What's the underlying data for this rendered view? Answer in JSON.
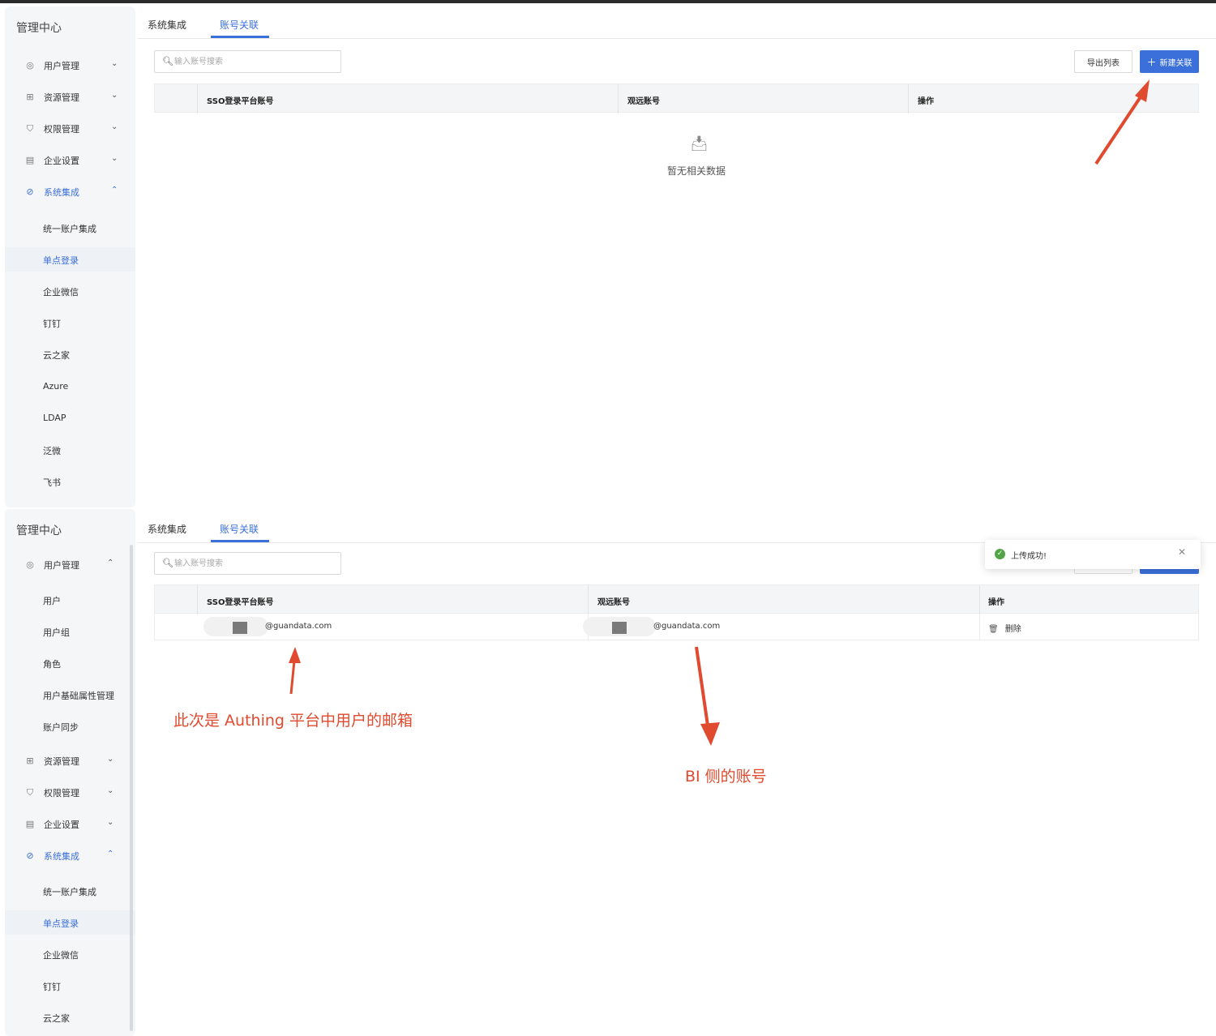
{
  "app": {
    "title": "管理中心"
  },
  "sidebar": {
    "menus": {
      "user": "用户管理",
      "resource": "资源管理",
      "permission": "权限管理",
      "enterprise": "企业设置",
      "integration": "系统集成"
    },
    "integration_items": [
      "统一账户集成",
      "单点登录",
      "企业微信",
      "钉钉",
      "云之家",
      "Azure",
      "LDAP",
      "泛微",
      "飞书"
    ],
    "user_items": [
      "用户",
      "用户组",
      "角色",
      "用户基础属性管理",
      "账户同步"
    ]
  },
  "tabs": [
    "系统集成",
    "账号关联"
  ],
  "search": {
    "placeholder": "输入账号搜索"
  },
  "toolbar": {
    "export_label": "导出列表",
    "new_label": "新建关联"
  },
  "table": {
    "headers": [
      "SSO登录平台账号",
      "观远账号",
      "操作"
    ],
    "empty_text": "暂无相关数据",
    "rows": [
      {
        "sso_account": "@guandata.com",
        "guan_account": "@guandata.com",
        "action": "删除"
      }
    ]
  },
  "toast": {
    "message": "上传成功!"
  },
  "annotations": {
    "sso_note": "此次是 Authing 平台中用户的邮箱",
    "bi_note": "BI 侧的账号"
  },
  "colors": {
    "accent": "#3b6fd9",
    "annotation": "#e04a2e",
    "success": "#52a447"
  },
  "icons": {
    "user": "user-circle-icon",
    "resource": "grid-icon",
    "permission": "shield-icon",
    "enterprise": "building-icon",
    "integration": "integration-icon"
  }
}
